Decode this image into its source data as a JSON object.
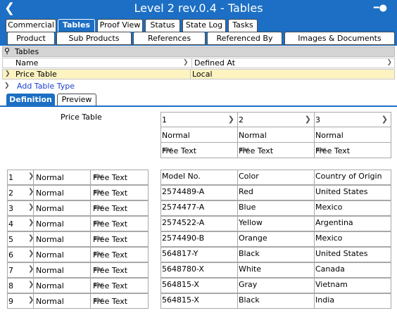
{
  "titlebar": {
    "back_icon": "back-chevron-icon",
    "title": "Level 2 rev.0.4 - Tables",
    "pin_icon": "pin-icon"
  },
  "tabs_main": [
    "Commercial",
    "Tables",
    "Proof View",
    "Status",
    "State Log",
    "Tasks"
  ],
  "tabs_main_active": "Tables",
  "tabs_sub": [
    "Product",
    "Sub Products",
    "References",
    "Referenced By",
    "Images & Documents"
  ],
  "tables_grid": {
    "title": "Tables",
    "col_name": "Name",
    "col_defined": "Defined At",
    "row": {
      "name": "Price Table",
      "defined": "Local"
    },
    "add_label": "Add Table Type"
  },
  "tabs_view": [
    "Definition",
    "Preview"
  ],
  "tabs_view_active": "Definition",
  "table_name": "Price Table",
  "columns": [
    {
      "num": "1",
      "style": "Normal",
      "type": "Free Text"
    },
    {
      "num": "2",
      "style": "Normal",
      "type": "Free Text"
    },
    {
      "num": "3",
      "style": "Normal",
      "type": "Free Text"
    }
  ],
  "rows_def": [
    {
      "num": "1",
      "style": "Normal",
      "type": "Free Text"
    },
    {
      "num": "2",
      "style": "Normal",
      "type": "Free Text"
    },
    {
      "num": "3",
      "style": "Normal",
      "type": "Free Text"
    },
    {
      "num": "4",
      "style": "Normal",
      "type": "Free Text"
    },
    {
      "num": "5",
      "style": "Normal",
      "type": "Free Text"
    },
    {
      "num": "6",
      "style": "Normal",
      "type": "Free Text"
    },
    {
      "num": "7",
      "style": "Normal",
      "type": "Free Text"
    },
    {
      "num": "8",
      "style": "Normal",
      "type": "Free Text"
    },
    {
      "num": "9",
      "style": "Normal",
      "type": "Free Text"
    }
  ],
  "data_rows": [
    [
      "Model No.",
      "Color",
      "Country of Origin"
    ],
    [
      "2574489-A",
      "Red",
      "United States"
    ],
    [
      "2574477-A",
      "Blue",
      "Mexico"
    ],
    [
      "2574522-A",
      "Yellow",
      "Argentina"
    ],
    [
      "2574490-B",
      "Orange",
      "Mexico"
    ],
    [
      "564817-Y",
      "Black",
      "United States"
    ],
    [
      "5648780-X",
      "White",
      "Canada"
    ],
    [
      "564815-X",
      "Gray",
      "Vietnam"
    ],
    [
      "564815-X",
      "Black",
      "India"
    ]
  ],
  "colors": {
    "accent": "#1c6fc4",
    "selected_row": "#fcf3c1",
    "link": "#1a3fd0"
  }
}
